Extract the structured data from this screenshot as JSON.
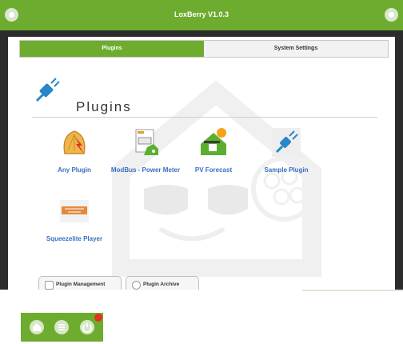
{
  "window": {
    "title": "LoxBerry V1.0.3"
  },
  "tabs": [
    {
      "label": "Plugins",
      "active": true
    },
    {
      "label": "System Settings",
      "active": false
    }
  ],
  "heading": {
    "label": "Plugins"
  },
  "plugins": [
    {
      "label": "Any Plugin",
      "icon": "any-plugin-icon"
    },
    {
      "label": "ModBus - Power Meter",
      "icon": "modbus-power-meter-icon"
    },
    {
      "label": "PV Forecast",
      "icon": "pv-forecast-icon"
    },
    {
      "label": "Sample Plugin",
      "icon": "sample-plugin-icon"
    },
    {
      "label": "Squeezelite Player",
      "icon": "squeezelite-player-icon"
    }
  ],
  "buttons": {
    "plugin_management": "Plugin Management",
    "plugin_archive": "Plugin Archive"
  },
  "dock": [
    "home-icon",
    "menu-icon",
    "power-icon"
  ],
  "colors": {
    "accent": "#6dac2f",
    "link": "#3a6fc2",
    "alert": "#e53020"
  }
}
